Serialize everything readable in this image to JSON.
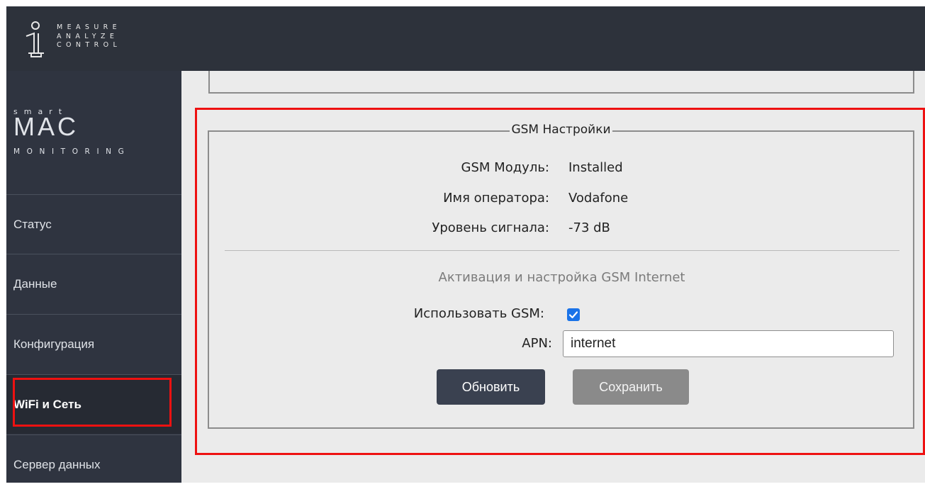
{
  "brand": {
    "top_logo_lines": [
      "MEASURE",
      "ANALYZE",
      "CONTROL"
    ],
    "smart": "smart",
    "mac": "MAC",
    "monitoring": "MONITORING"
  },
  "sidebar": {
    "items": [
      {
        "label": "Статус"
      },
      {
        "label": "Данные"
      },
      {
        "label": "Конфигурация"
      },
      {
        "label": "WiFi и Сеть",
        "active": true
      },
      {
        "label": "Сервер данных"
      }
    ]
  },
  "gsm": {
    "legend": "GSM Настройки",
    "module_label": "GSM Модуль:",
    "module_value": "Installed",
    "operator_label": "Имя оператора:",
    "operator_value": "Vodafone",
    "signal_label": "Уровень сигнала:",
    "signal_value": "-73 dB",
    "section_title": "Активация и настройка GSM Internet",
    "use_gsm_label": "Использовать GSM:",
    "use_gsm_checked": true,
    "apn_label": "APN:",
    "apn_value": "internet",
    "refresh_label": "Обновить",
    "save_label": "Сохранить"
  },
  "colors": {
    "topbar": "#2d323b",
    "sidebar": "#2f3440",
    "highlight": "#ee1111",
    "checkbox": "#1a73e8",
    "refresh_button": "#3a4150",
    "save_button_disabled": "#8a8a8a"
  }
}
